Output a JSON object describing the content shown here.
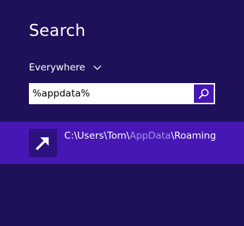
{
  "charm": {
    "title": "Search"
  },
  "scope": {
    "label": "Everywhere",
    "icon": "chevron-down-icon"
  },
  "search": {
    "value": "%appdata%",
    "button_icon": "magnifier-icon"
  },
  "results": [
    {
      "icon": "arrow-up-right-icon",
      "path_prefix": "C:\\Users\\Tom\\",
      "path_highlight": "AppData",
      "path_suffix": "\\Roaming"
    }
  ],
  "colors": {
    "background": "#1e1159",
    "accent": "#4617b4",
    "tile": "#2d117f",
    "highlight_text": "#a88ef0"
  }
}
